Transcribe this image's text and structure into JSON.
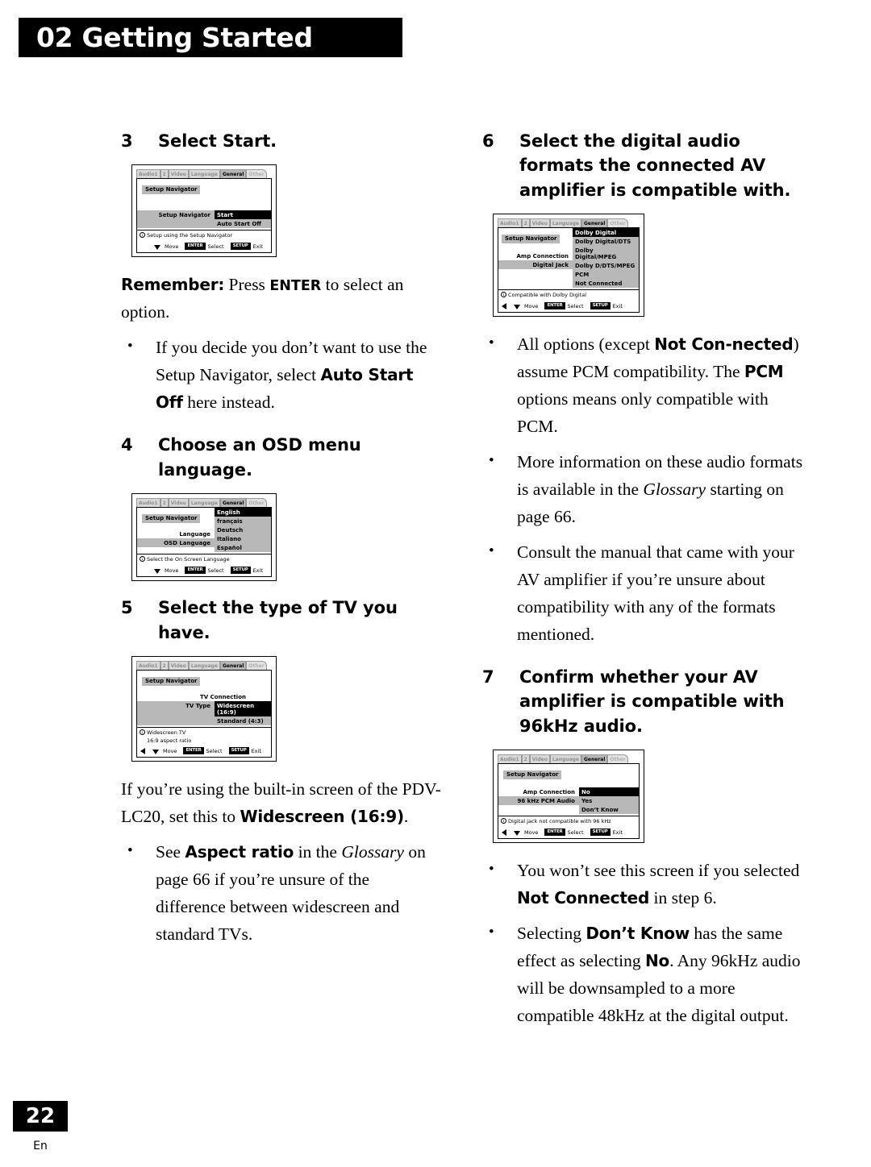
{
  "header": {
    "chapter": "02",
    "title": "02 Getting Started"
  },
  "footer": {
    "page_number": "22",
    "language_code": "En"
  },
  "colors": {
    "ink": "#000000",
    "paper": "#ffffff",
    "osd_shade": "#b8b8b8",
    "osd_highlight": "#000000"
  },
  "left_column": {
    "step3": {
      "number": "3",
      "heading": "Select Start."
    },
    "remember": {
      "lead": "Remember:",
      "text_before": " Press ",
      "key": "ENTER",
      "text_after": " to select an option."
    },
    "bullet_autostart": {
      "part1": "If you decide you don’t want to use the Setup Navigator, select ",
      "bold": "Auto Start Off",
      "part2": " here instead."
    },
    "step4": {
      "number": "4",
      "heading": "Choose an OSD menu language."
    },
    "step5": {
      "number": "5",
      "heading": "Select the type of TV you have."
    },
    "widescreen_para": {
      "part1": "If you’re using the built-in screen of the PDV-LC20, set this to ",
      "bold": "Widescreen (16:9)",
      "part2": "."
    },
    "bullet_aspect": {
      "part1": "See ",
      "bold": "Aspect ratio",
      "part2": " in the ",
      "italic": "Glossary",
      "part3": " on page 66 if you’re unsure of the difference between widescreen and standard TVs."
    }
  },
  "right_column": {
    "step6": {
      "number": "6",
      "heading": "Select the digital audio formats the connected AV amplifier is compatible with."
    },
    "bullet_pcm": {
      "part1": "All options (except ",
      "bold1": "Not Con-nected",
      "part2": ") assume PCM compatibility. The ",
      "bold2": "PCM",
      "part3": " options means only compatible with PCM."
    },
    "bullet_glossary": {
      "part1": "More information on these audio formats is available in the ",
      "italic": "Glossary",
      "part2": " starting on page 66."
    },
    "bullet_consult": {
      "text": "Consult the manual that came with your AV amplifier if you’re unsure about compatibility with any of the formats mentioned."
    },
    "step7": {
      "number": "7",
      "heading": "Confirm whether your AV amplifier is compatible with 96kHz audio."
    },
    "bullet_notconnected": {
      "part1": "You won’t see this screen if you selected ",
      "bold": "Not Connected",
      "part2": " in step 6."
    },
    "bullet_dontknow": {
      "part1": "Selecting ",
      "bold1": "Don’t Know",
      "part2": " has the same effect as selecting ",
      "bold2": "No",
      "part3": ". Any 96kHz audio will be downsampled to a more compatible 48kHz at the digital output."
    }
  },
  "osd_common": {
    "tabs": [
      "Audio1",
      "2",
      "Video",
      "Language",
      "General",
      "Other"
    ],
    "selected_tab": "General",
    "panel_title": "Setup Navigator",
    "footer": {
      "move_label": "Move",
      "enter_badge": "ENTER",
      "select_label": "Select",
      "setup_badge": "SETUP",
      "exit_label": "Exit"
    }
  },
  "osd_screens": [
    {
      "id": "setup-navigator-start",
      "title": "Setup Navigator",
      "row_label": "Setup Navigator",
      "options": [
        "Start",
        "Auto Start Off"
      ],
      "highlighted": "Start",
      "hint": "Setup using the Setup Navigator",
      "hint2": "",
      "has_left_arrow": false
    },
    {
      "id": "osd-language",
      "title": "Setup Navigator",
      "row_label": "Language",
      "row_label2": "OSD Language",
      "options": [
        "English",
        "français",
        "Deutsch",
        "Italiano",
        "Español"
      ],
      "highlighted": "English",
      "hint": "Select the On Screen Language",
      "hint2": "",
      "has_left_arrow": false
    },
    {
      "id": "tv-type",
      "title": "Setup Navigator",
      "row_label": "TV Connection",
      "row_label2": "TV Type",
      "options": [
        "Widescreen (16:9)",
        "Standard (4:3)"
      ],
      "highlighted": "Widescreen (16:9)",
      "hint": "Widescreen TV",
      "hint2": "16:9 aspect ratio",
      "has_left_arrow": true
    },
    {
      "id": "digital-jack",
      "title": "Setup Navigator",
      "row_label": "Amp Connection",
      "row_label2": "Digital Jack",
      "options": [
        "Dolby Digital",
        "Dolby Digital/DTS",
        "Dolby Digital/MPEG",
        "Dolby D/DTS/MPEG",
        "PCM",
        "Not Connected"
      ],
      "highlighted": "Dolby Digital",
      "hint": "Compatible with Dolby Digital",
      "hint2": "",
      "has_left_arrow": true
    },
    {
      "id": "96khz-pcm-audio",
      "title": "Setup Navigator",
      "row_label": "Amp Connection",
      "row_label2": "96 kHz PCM Audio",
      "options": [
        "No",
        "Yes",
        "Don’t Know"
      ],
      "highlighted": "No",
      "hint": "Digital jack not compatible with 96 kHz",
      "hint2": "",
      "has_left_arrow": true
    }
  ]
}
